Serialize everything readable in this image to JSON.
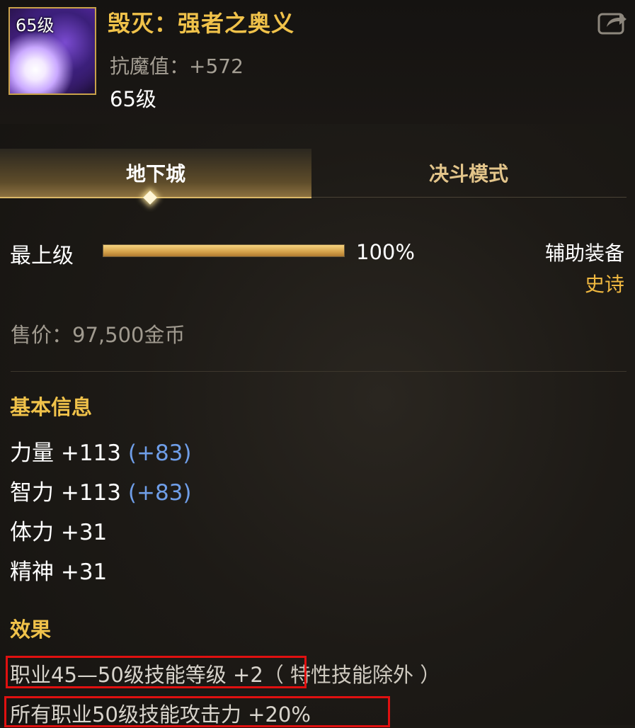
{
  "item": {
    "icon_level": "65级",
    "name": "毁灭：强者之奥义",
    "resist_label": "抗魔值：",
    "resist_value": "+572",
    "required_level": "65级"
  },
  "tabs": [
    {
      "label": "地下城",
      "active": true
    },
    {
      "label": "决斗模式",
      "active": false
    }
  ],
  "grade": {
    "label": "最上级",
    "percent_text": "100%",
    "fill_fraction": 1.0
  },
  "equipment": {
    "type": "辅助装备",
    "rarity": "史诗",
    "rarity_color": "#f0b840"
  },
  "price": "售价：97,500金币",
  "basic_info": {
    "title": "基本信息",
    "stats": [
      {
        "name": "力量",
        "value": "+113",
        "bonus": "(+83)"
      },
      {
        "name": "智力",
        "value": "+113",
        "bonus": "(+83)"
      },
      {
        "name": "体力",
        "value": "+31",
        "bonus": ""
      },
      {
        "name": "精神",
        "value": "+31",
        "bonus": ""
      }
    ]
  },
  "effects": {
    "title": "效果",
    "lines": [
      {
        "main": "职业45—50级技能等级 +2",
        "note": "（ 特性技能除外 ）"
      },
      {
        "main": "所有职业50级技能攻击力 +20%",
        "note": ""
      }
    ]
  },
  "icons": {
    "share": "share-icon"
  }
}
